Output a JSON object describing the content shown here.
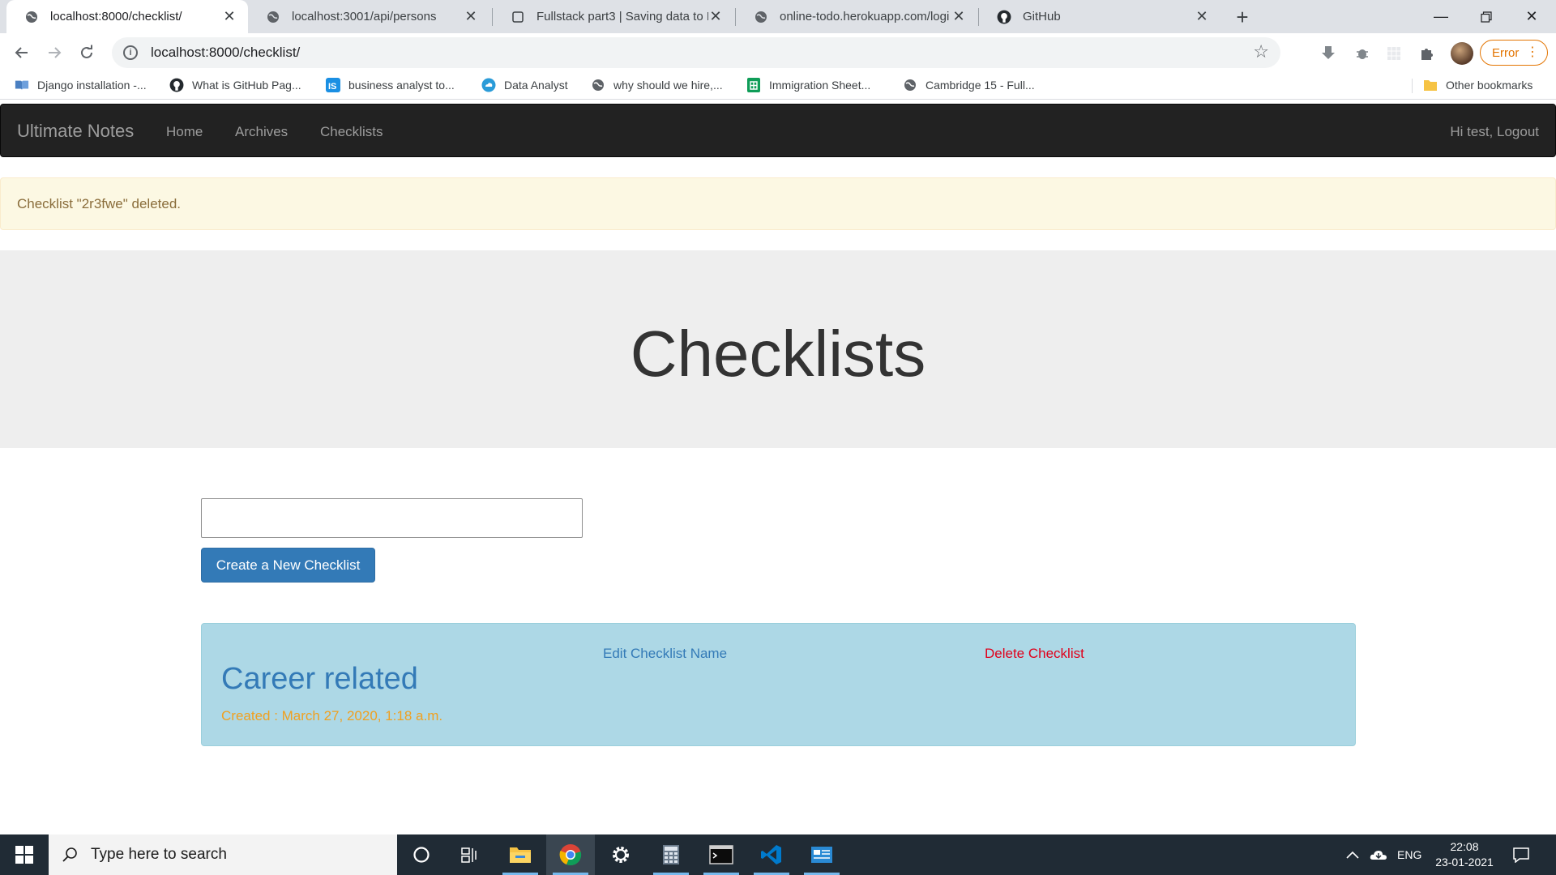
{
  "browser": {
    "tabs": [
      {
        "title": "localhost:8000/checklist/",
        "icon": "globe-icon",
        "active": true
      },
      {
        "title": "localhost:3001/api/persons",
        "icon": "globe-icon",
        "active": false
      },
      {
        "title": "Fullstack part3 | Saving data to M",
        "icon": "page-icon",
        "active": false
      },
      {
        "title": "online-todo.herokuapp.com/logi",
        "icon": "globe-icon",
        "active": false
      },
      {
        "title": "GitHub",
        "icon": "github-icon",
        "active": false
      }
    ],
    "address_url": "localhost:8000/checklist/",
    "profile_status": "Error",
    "bookmarks": [
      {
        "label": "Django installation -...",
        "icon": "book-icon"
      },
      {
        "label": "What is GitHub Pag...",
        "icon": "github-icon"
      },
      {
        "label": "business analyst to...",
        "icon": "is-logo-icon"
      },
      {
        "label": "Data Analyst",
        "icon": "cloud-icon"
      },
      {
        "label": "why should we hire,...",
        "icon": "globe-icon"
      },
      {
        "label": "Immigration Sheet...",
        "icon": "sheets-icon"
      },
      {
        "label": "Cambridge 15 - Full...",
        "icon": "globe-icon"
      }
    ],
    "other_bookmarks": "Other bookmarks"
  },
  "navbar": {
    "brand": "Ultimate Notes",
    "links": [
      "Home",
      "Archives",
      "Checklists"
    ],
    "greeting": "Hi test, Logout"
  },
  "alert": {
    "message": "Checklist \"2r3fwe\" deleted.",
    "color": "#fcf8e3"
  },
  "page": {
    "heading": "Checklists",
    "new_checklist_input": "",
    "create_button": "Create a New Checklist"
  },
  "checklists": [
    {
      "name": "Career related",
      "edit_label": "Edit Checklist Name",
      "delete_label": "Delete Checklist",
      "created": "Created : March 27, 2020, 1:18 a.m."
    }
  ],
  "taskbar": {
    "search_placeholder": "Type here to search",
    "apps": [
      "cortana-icon",
      "task-view-icon",
      "file-explorer-icon",
      "chrome-icon",
      "settings-icon",
      "calculator-icon",
      "terminal-icon",
      "vscode-icon",
      "app-icon"
    ],
    "language": "ENG",
    "time": "22:08",
    "date": "23-01-2021"
  },
  "colors": {
    "navbar_bg": "#222222",
    "primary": "#337ab7",
    "card_bg": "#add8e6",
    "delete": "#e0001b",
    "created": "#f0a020"
  }
}
